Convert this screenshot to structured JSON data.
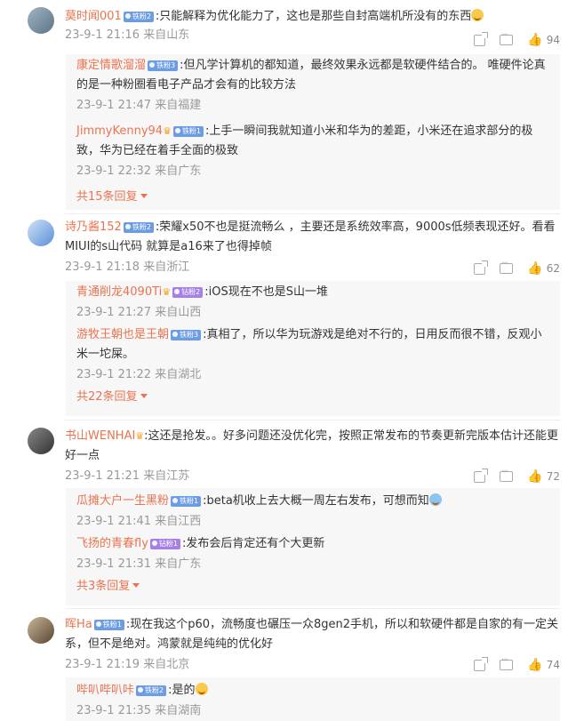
{
  "comments": [
    {
      "user": "莫时闻001",
      "badge": "铁粉2",
      "text": ":只能解释为优化能力了，这也是那些自封高端机所没有的东西",
      "time": "23-9-1 21:16 来自山东",
      "likes": "94",
      "replies": [
        {
          "user": "康定情歌溜溜",
          "badge": "铁粉3",
          "text": ":但凡学计算机的都知道，最终效果永远都是软硬件结合的。 唯硬件论真的是一种粉圈看电子产品才会有的比较方法",
          "time": "23-9-1 21:47 来自福建"
        },
        {
          "user": "JimmyKenny94",
          "badge": "铁粉1",
          "text": ":上手一瞬间我就知道小米和华为的差距，小米还在追求部分的极致，华为已经在着手全面的极致",
          "time": "23-9-1 22:32 来自广东"
        }
      ],
      "more": "共15条回复"
    },
    {
      "user": "诗乃酱152",
      "badge": "铁粉2",
      "text": ":荣耀x50不也是挺流畅么 ，主要还是系统效率高，9000s低频表现还好。看看MIUI的s山代码 就算是a16来了也得掉帧",
      "time": "23-9-1 21:18 来自浙江",
      "likes": "62",
      "replies": [
        {
          "user": "青通削龙4090Ti",
          "badge": "钻粉2",
          "text": ":iOS现在不也是S山一堆",
          "time": "23-9-1 21:27 来自山西"
        },
        {
          "user": "游牧王朝也是王朝",
          "badge": "铁粉3",
          "text": ":真相了，所以华为玩游戏是绝对不行的，日用反而很不错，反观小米一坨屎。",
          "time": "23-9-1 21:22 来自湖北"
        }
      ],
      "more": "共22条回复"
    },
    {
      "user": "书山WENHAI",
      "badge": "",
      "text": ":这还是抢发。。好多问题还没优化完，按照正常发布的节奏更新完版本估计还能更好一点",
      "time": "23-9-1 21:21 来自江苏",
      "likes": "72",
      "replies": [
        {
          "user": "瓜摊大户一生黑粉",
          "badge": "铁粉1",
          "text": ":beta机收上去大概一周左右发布，可想而知",
          "time": "23-9-1 21:41 来自江西"
        },
        {
          "user": "飞扬的青春fly",
          "badge": "钻粉1",
          "text": ":发布会后肯定还有个大更新",
          "time": "23-9-1 21:31 来自广东"
        }
      ],
      "more": "共3条回复"
    },
    {
      "user": "晖Ha",
      "badge": "铁粉1",
      "text": ":现在我这个p60，流畅度也碾压一众8gen2手机，所以和软硬件都是自家的有一定关系，但不是绝对。鸿蒙就是纯纯的优化好",
      "time": "23-9-1 21:19 来自北京",
      "likes": "74",
      "replies": [
        {
          "user": "哔叭哔叭咔",
          "badge": "铁粉2",
          "text": ":是的",
          "time": "23-9-1 21:35 来自湖南"
        }
      ],
      "more": ""
    }
  ],
  "colors": {
    "username": "#eb7350",
    "meta": "#999999",
    "reply_bg": "#f7f7f7"
  }
}
